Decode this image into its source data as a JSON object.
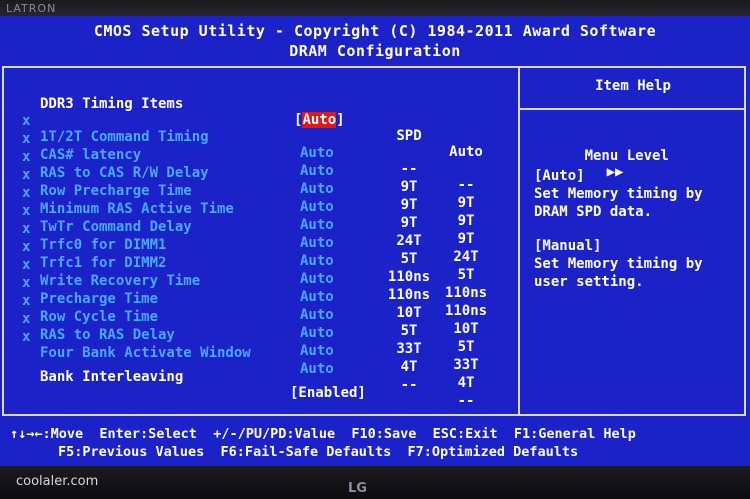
{
  "monitor": {
    "brand": "LATRON",
    "logo": "LG"
  },
  "bios": {
    "title_line1": "CMOS Setup Utility - Copyright (C) 1984-2011 Award Software",
    "title_line2": "DRAM Configuration"
  },
  "timing": {
    "header_label": "DDR3 Timing Items",
    "header_value": "Auto",
    "col_spd": "SPD",
    "col_auto": "Auto",
    "items": [
      {
        "label": "1T/2T Command Timing",
        "value": "Auto",
        "spd": "--",
        "auto": "--"
      },
      {
        "label": "CAS# latency",
        "value": "Auto",
        "spd": "9T",
        "auto": "9T"
      },
      {
        "label": "RAS to CAS R/W Delay",
        "value": "Auto",
        "spd": "9T",
        "auto": "9T"
      },
      {
        "label": "Row Precharge Time",
        "value": "Auto",
        "spd": "9T",
        "auto": "9T"
      },
      {
        "label": "Minimum RAS Active Time",
        "value": "Auto",
        "spd": "24T",
        "auto": "24T"
      },
      {
        "label": "TwTr Command Delay",
        "value": "Auto",
        "spd": "5T",
        "auto": "5T"
      },
      {
        "label": "Trfc0 for DIMM1",
        "value": "Auto",
        "spd": "110ns",
        "auto": "110ns"
      },
      {
        "label": "Trfc1 for DIMM2",
        "value": "Auto",
        "spd": "110ns",
        "auto": "110ns"
      },
      {
        "label": "Write Recovery Time",
        "value": "Auto",
        "spd": "10T",
        "auto": "10T"
      },
      {
        "label": "Precharge Time",
        "value": "Auto",
        "spd": "5T",
        "auto": "5T"
      },
      {
        "label": "Row Cycle Time",
        "value": "Auto",
        "spd": "33T",
        "auto": "33T"
      },
      {
        "label": "RAS to RAS Delay",
        "value": "Auto",
        "spd": "4T",
        "auto": "4T"
      },
      {
        "label": "Four Bank Activate Window",
        "value": "Auto",
        "spd": "--",
        "auto": "--"
      }
    ],
    "item_marker": "x",
    "bank_label": "Bank Interleaving",
    "bank_value": "[Enabled]"
  },
  "help": {
    "title": "Item Help",
    "menu_level_label": "Menu Level",
    "menu_level_arrows": "▶▶",
    "auto_heading": "[Auto]",
    "auto_line1": "Set Memory timing by",
    "auto_line2": "DRAM SPD data.",
    "manual_heading": "[Manual]",
    "manual_line1": "Set Memory timing by",
    "manual_line2": "user setting."
  },
  "footer": {
    "line1": "↑↓→←:Move  Enter:Select  +/-/PU/PD:Value  F10:Save  ESC:Exit  F1:General Help",
    "line2": "F5:Previous Values  F6:Fail-Safe Defaults  F7:Optimized Defaults"
  },
  "watermark": "coolaler.com"
}
